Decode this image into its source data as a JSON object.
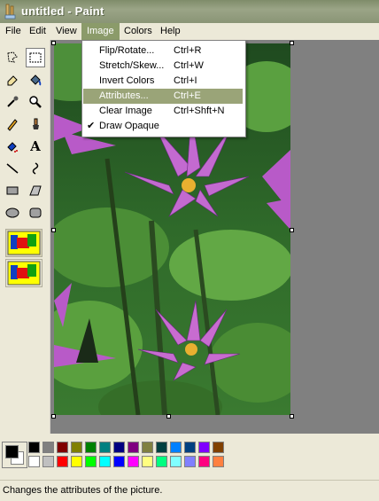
{
  "window": {
    "title": "untitled - Paint"
  },
  "menubar": {
    "items": [
      {
        "label": "File"
      },
      {
        "label": "Edit"
      },
      {
        "label": "View"
      },
      {
        "label": "Image"
      },
      {
        "label": "Colors"
      },
      {
        "label": "Help"
      }
    ],
    "active": "Image"
  },
  "image_menu": {
    "items": [
      {
        "label": "Flip/Rotate...",
        "shortcut": "Ctrl+R"
      },
      {
        "label": "Stretch/Skew...",
        "shortcut": "Ctrl+W"
      },
      {
        "label": "Invert Colors",
        "shortcut": "Ctrl+I"
      },
      {
        "label": "Attributes...",
        "shortcut": "Ctrl+E"
      },
      {
        "label": "Clear Image",
        "shortcut": "Ctrl+Shft+N"
      },
      {
        "label": "Draw Opaque",
        "shortcut": ""
      }
    ],
    "highlighted": "Attributes...",
    "checked": "Draw Opaque",
    "check_glyph": "✔"
  },
  "tools": {
    "icons": [
      "free-select",
      "rect-select",
      "eraser",
      "fill",
      "color-picker",
      "magnifier",
      "pencil",
      "brush",
      "airbrush",
      "text",
      "line",
      "curve",
      "rectangle",
      "polygon",
      "ellipse",
      "rounded-rectangle"
    ],
    "selected": "rect-select",
    "text_glyph": "A"
  },
  "palette": {
    "foreground": "#000000",
    "background": "#ffffff",
    "row1": [
      "#000000",
      "#808080",
      "#800000",
      "#808000",
      "#008000",
      "#008080",
      "#000080",
      "#800080",
      "#808040",
      "#004040",
      "#0080ff",
      "#004080",
      "#8000ff",
      "#804000"
    ],
    "row2": [
      "#ffffff",
      "#c0c0c0",
      "#ff0000",
      "#ffff00",
      "#00ff00",
      "#00ffff",
      "#0000ff",
      "#ff00ff",
      "#ffff80",
      "#00ff80",
      "#80ffff",
      "#8080ff",
      "#ff0080",
      "#ff8040"
    ]
  },
  "status": {
    "text": "Changes the attributes of the picture."
  }
}
